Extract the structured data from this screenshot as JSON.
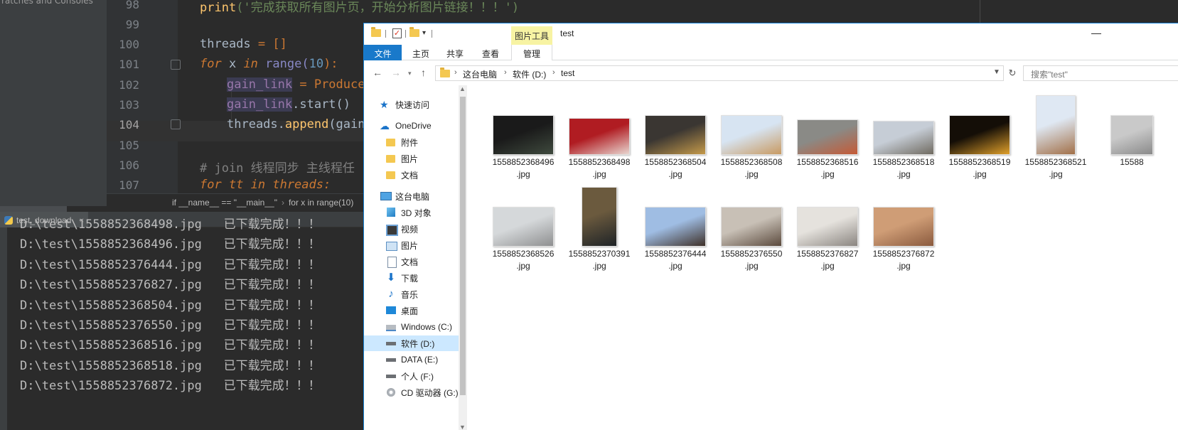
{
  "ide": {
    "sidebar_label": "ratches and Consoles",
    "line_numbers": [
      "98",
      "99",
      "100",
      "101",
      "102",
      "103",
      "104",
      "105",
      "106",
      "107"
    ],
    "code": {
      "l98_print": "print",
      "l98_str": "('完成获取所有图片页，开始分析图片链接！！！')",
      "l100_var": "threads",
      "l100_rest": " = []",
      "l101_for": "for",
      "l101_x": " x ",
      "l101_in": "in",
      "l101_range": " range(",
      "l101_num": "10",
      "l101_end": "):",
      "l102_var": "gain_link",
      "l102_rest": " = Producer",
      "l103_var": "gain_link",
      "l103_rest": ".start()",
      "l104_a": "threads.",
      "l104_b": "append",
      "l104_c": "(gain_l",
      "l106_cmt": "# join 线程同步 主线程任",
      "l107_cut": "for tt in threads:"
    },
    "breadcrumb": [
      "if __name__ == \"__main__\"",
      "for x in range(10)"
    ],
    "run_tab": "test_download",
    "console_lines": [
      "D:\\test\\1558852368498.jpg   已下载完成！！！",
      "D:\\test\\1558852368496.jpg   已下载完成！！！",
      "D:\\test\\1558852376444.jpg   已下载完成！！！",
      "D:\\test\\1558852376827.jpg   已下载完成！！！",
      "D:\\test\\1558852368504.jpg   已下载完成！！！",
      "D:\\test\\1558852376550.jpg   已下载完成！！！",
      "D:\\test\\1558852368516.jpg   已下载完成！！！",
      "D:\\test\\1558852368518.jpg   已下载完成！！！",
      "D:\\test\\1558852376872.jpg   已下载完成！！！"
    ]
  },
  "explorer": {
    "title": "test",
    "tools_tab": "图片工具",
    "ribbon_tabs": [
      "文件",
      "主页",
      "共享",
      "查看",
      "管理"
    ],
    "address": [
      "这台电脑",
      "软件 (D:)",
      "test"
    ],
    "search_placeholder": "搜索\"test\"",
    "nav": [
      {
        "label": "快速访问",
        "icon": "star-icon"
      },
      {
        "label": "OneDrive",
        "icon": "cloud-icon"
      },
      {
        "label": "附件",
        "icon": "folder-icon"
      },
      {
        "label": "图片",
        "icon": "folder-icon"
      },
      {
        "label": "文档",
        "icon": "folder-icon"
      },
      {
        "label": "这台电脑",
        "icon": "computer-icon"
      },
      {
        "label": "3D 对象",
        "icon": "3d-objects-icon"
      },
      {
        "label": "视频",
        "icon": "video-icon"
      },
      {
        "label": "图片",
        "icon": "pictures-icon"
      },
      {
        "label": "文档",
        "icon": "documents-icon"
      },
      {
        "label": "下载",
        "icon": "download-icon"
      },
      {
        "label": "音乐",
        "icon": "music-icon"
      },
      {
        "label": "桌面",
        "icon": "desktop-icon"
      },
      {
        "label": "Windows (C:)",
        "icon": "windows-drive-icon"
      },
      {
        "label": "软件 (D:)",
        "icon": "drive-icon",
        "selected": true
      },
      {
        "label": "DATA (E:)",
        "icon": "drive-icon"
      },
      {
        "label": "个人 (F:)",
        "icon": "drive-icon"
      },
      {
        "label": "CD 驱动器 (G:)",
        "icon": "cd-drive-icon"
      }
    ],
    "files": [
      {
        "name": "1558852368496",
        "ext": ".jpg",
        "colors": [
          "#1a1a1a",
          "#3f4a3e"
        ]
      },
      {
        "name": "1558852368498",
        "ext": ".jpg",
        "colors": [
          "#b01c22",
          "#e8d6d0"
        ]
      },
      {
        "name": "1558852368504",
        "ext": ".jpg",
        "colors": [
          "#3a3632",
          "#c59a4a"
        ]
      },
      {
        "name": "1558852368508",
        "ext": ".jpg",
        "colors": [
          "#d7e4f2",
          "#c89a62"
        ]
      },
      {
        "name": "1558852368516",
        "ext": ".jpg",
        "colors": [
          "#8a8a86",
          "#c55a36"
        ]
      },
      {
        "name": "1558852368518",
        "ext": ".jpg",
        "colors": [
          "#c6cdd6",
          "#6f6a60"
        ]
      },
      {
        "name": "1558852368519",
        "ext": ".jpg",
        "colors": [
          "#140e07",
          "#e0a02a"
        ]
      },
      {
        "name": "1558852368521",
        "ext": ".jpg",
        "colors": [
          "#dfe8f3",
          "#a27048"
        ]
      },
      {
        "name": "15588",
        "ext": "",
        "colors": [
          "#c9c9c9",
          "#8a8a8a"
        ]
      },
      {
        "name": "1558852368526",
        "ext": ".jpg",
        "colors": [
          "#d5d8da",
          "#8e8f90"
        ]
      },
      {
        "name": "1558852370391",
        "ext": ".jpg",
        "colors": [
          "#6b5a3e",
          "#1e2327"
        ]
      },
      {
        "name": "1558852376444",
        "ext": ".jpg",
        "colors": [
          "#9fbde3",
          "#3e3028"
        ]
      },
      {
        "name": "1558852376550",
        "ext": ".jpg",
        "colors": [
          "#c8c0b6",
          "#5b4a3d"
        ]
      },
      {
        "name": "1558852376827",
        "ext": ".jpg",
        "colors": [
          "#e5e2dd",
          "#8a8580"
        ]
      },
      {
        "name": "1558852376872",
        "ext": ".jpg",
        "colors": [
          "#cf9d76",
          "#8a5a3e"
        ]
      }
    ]
  }
}
